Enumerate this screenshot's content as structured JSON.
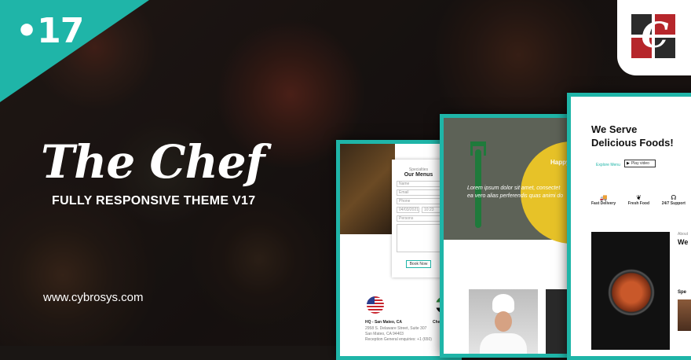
{
  "badge": {
    "version": "17"
  },
  "hero": {
    "title": "The Chef",
    "subtitle": "FULLY RESPONSIVE THEME V17",
    "website": "www.cybrosys.com"
  },
  "card_menus": {
    "eyebrow": "Specialties",
    "heading": "Our Menus",
    "book_button": "Book Now",
    "fields": [
      "Name",
      "Email",
      "Phone",
      "04/03/2021",
      "10:23",
      "Persons"
    ],
    "location": {
      "title": "HQ - San Mateo, CA",
      "line1": "2958 S. Delaware Street, Suite 307",
      "line2": "San Mateo, CA 94403",
      "line3": "Reception General enquiries: +1 (650)"
    },
    "location2_title": "Cheri"
  },
  "card_happy": {
    "heading": "Happy",
    "body_line1": "Lorem ipsum dolor sit amet, consectet",
    "body_line2": "ea vero alias perferendis quas animi do"
  },
  "card_serve": {
    "heading_line1": "We Serve",
    "heading_line2": "Delicious Foods!",
    "explore_link": "Explore Menu",
    "play_button": "Play video",
    "features": [
      {
        "icon": "truck-icon",
        "label": "Fast Delivery"
      },
      {
        "icon": "leaf-icon",
        "label": "Fresh Food"
      },
      {
        "icon": "headset-icon",
        "label": "24/7 Support"
      }
    ],
    "side_small": "About",
    "side_heading": "We",
    "side_heading2": "Spe"
  },
  "colors": {
    "accent": "#1fb5a8",
    "logo_red": "#b6262b",
    "logo_dark": "#2b2b2b"
  }
}
